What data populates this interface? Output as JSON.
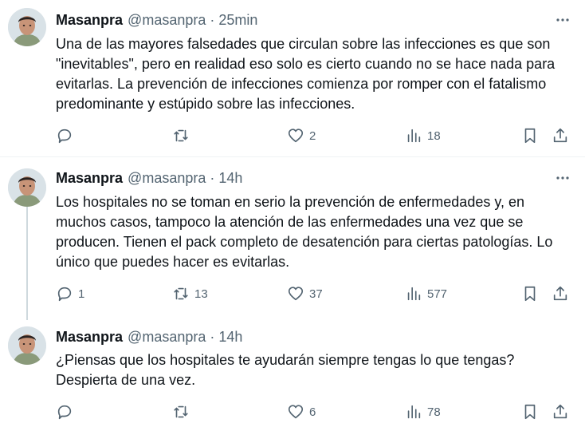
{
  "tweets": [
    {
      "author": "Masanpra",
      "handle": "@masanpra",
      "separator": "·",
      "time": "25min",
      "lines": [
        "Una de las mayores falsedades que circulan sobre las infecciones es que son",
        "\"inevitables\", pero en realidad eso solo es cierto cuando no se hace nada para",
        "evitarlas. La prevención de infecciones comienza por romper con el fatalismo",
        "predominante y estúpido sobre las infecciones."
      ],
      "replies": "",
      "retweets": "",
      "likes": "2",
      "views": "18"
    },
    {
      "author": "Masanpra",
      "handle": "@masanpra",
      "separator": "·",
      "time": "14h",
      "lines": [
        "Los hospitales no se toman en serio la prevención de enfermedades y, en",
        "muchos casos, tampoco la atención de las enfermedades una vez que se",
        "producen. Tienen el pack completo de desatención para ciertas patologías. Lo",
        "único que puedes hacer es evitarlas."
      ],
      "replies": "1",
      "retweets": "13",
      "likes": "37",
      "views": "577"
    },
    {
      "author": "Masanpra",
      "handle": "@masanpra",
      "separator": "·",
      "time": "14h",
      "lines": [
        "¿Piensas que los hospitales te ayudarán siempre tengas lo que tengas?",
        "Despierta de una vez."
      ],
      "replies": "",
      "retweets": "",
      "likes": "6",
      "views": "78"
    }
  ],
  "colors": {
    "text": "#0f1419",
    "secondary": "#536471",
    "divider": "#eff3f4",
    "thread_line": "#cfd9de"
  },
  "icons": [
    "avatar",
    "more-icon",
    "reply-icon",
    "retweet-icon",
    "like-icon",
    "views-icon",
    "bookmark-icon",
    "share-icon"
  ]
}
